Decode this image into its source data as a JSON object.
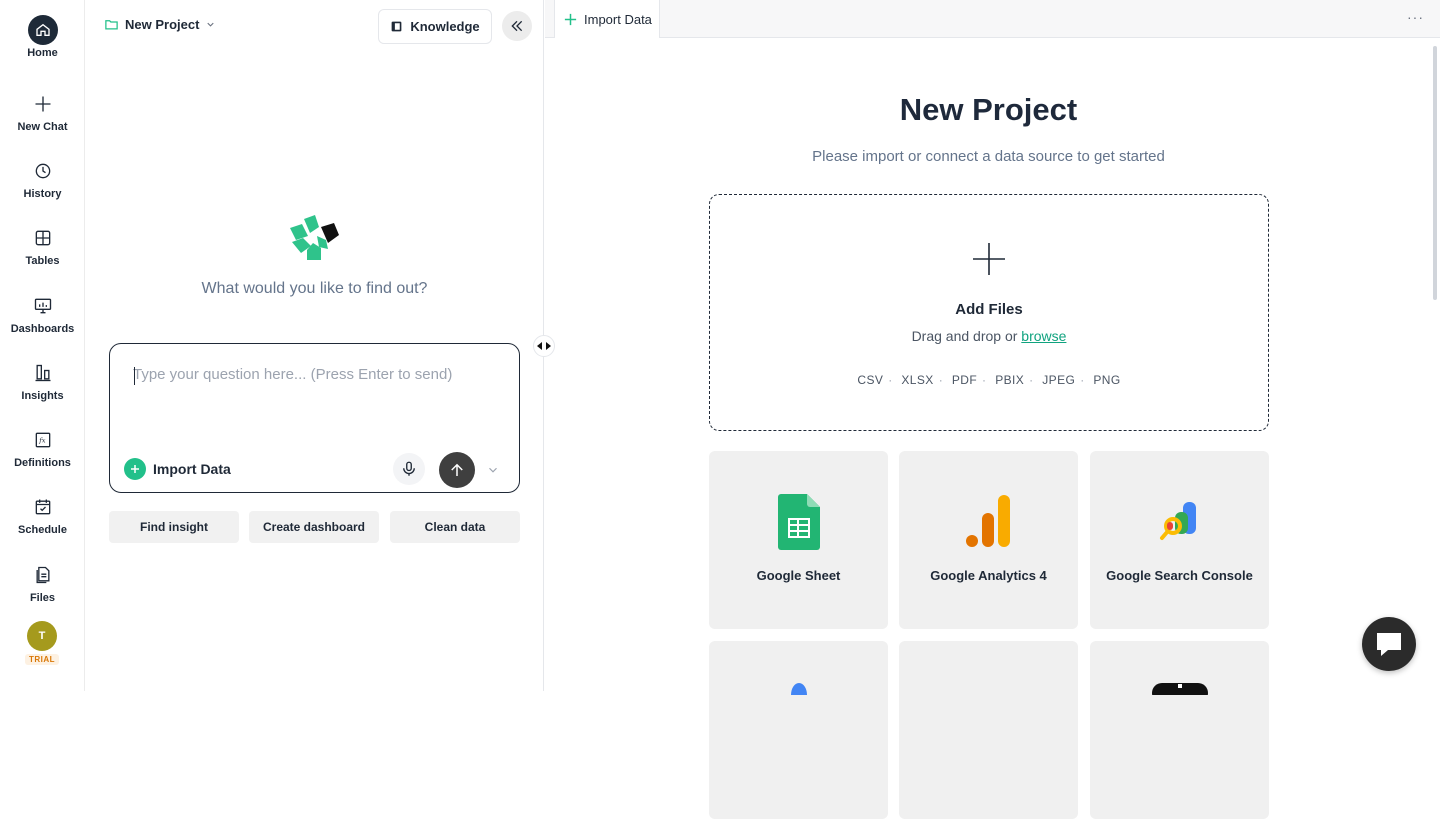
{
  "sidebar": {
    "items": [
      {
        "label": "Home",
        "icon": "home-icon"
      },
      {
        "label": "New Chat",
        "icon": "plus-icon"
      },
      {
        "label": "History",
        "icon": "history-icon"
      },
      {
        "label": "Tables",
        "icon": "table-icon"
      },
      {
        "label": "Dashboards",
        "icon": "dashboard-icon"
      },
      {
        "label": "Insights",
        "icon": "insights-icon"
      },
      {
        "label": "Definitions",
        "icon": "formula-icon"
      },
      {
        "label": "Schedule",
        "icon": "calendar-icon"
      },
      {
        "label": "Files",
        "icon": "files-icon"
      }
    ],
    "avatar_initial": "T",
    "plan_badge": "TRIAL"
  },
  "chat": {
    "project_name": "New Project",
    "knowledge_label": "Knowledge",
    "prompt_question": "What would you like to find out?",
    "input_placeholder": "Type your question here... (Press Enter to send)",
    "import_label": "Import Data",
    "suggestions": [
      "Find insight",
      "Create dashboard",
      "Clean data"
    ]
  },
  "main": {
    "tab_label": "Import Data",
    "title": "New Project",
    "subtitle": "Please import or connect a data source to get started",
    "dropzone": {
      "title": "Add Files",
      "hint_prefix": "Drag and drop or",
      "browse_label": "browse",
      "formats": [
        "CSV",
        "XLSX",
        "PDF",
        "PBIX",
        "JPEG",
        "PNG"
      ]
    },
    "sources": [
      {
        "label": "Google Sheet",
        "icon": "google-sheets-icon"
      },
      {
        "label": "Google Analytics 4",
        "icon": "google-analytics-icon"
      },
      {
        "label": "Google Search Console",
        "icon": "google-search-console-icon"
      }
    ]
  },
  "colors": {
    "accent": "#22c08a",
    "link": "#10a37f",
    "dark": "#1e2a38",
    "trial": "#d97706"
  }
}
